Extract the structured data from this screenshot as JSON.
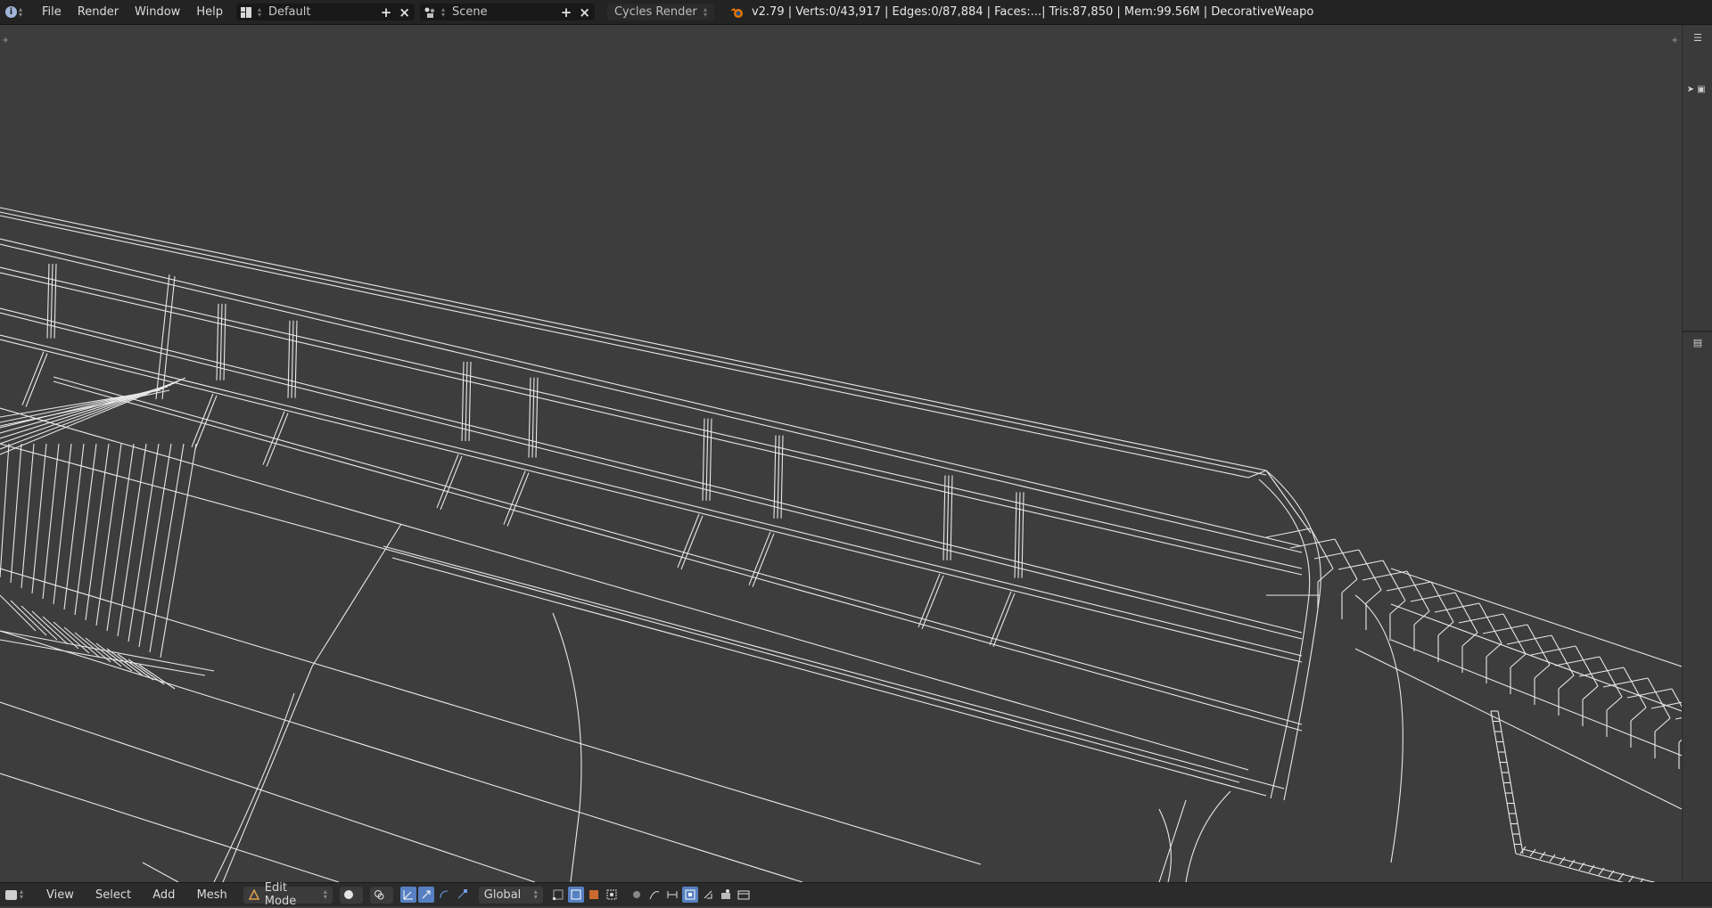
{
  "top_header": {
    "menus": [
      "File",
      "Render",
      "Window",
      "Help"
    ],
    "screen_layout": "Default",
    "scene": "Scene",
    "render_engine": "Cycles Render",
    "stats": "v2.79 | Verts:0/43,917 | Edges:0/87,884 | Faces:...| Tris:87,850 | Mem:99.56M | DecorativeWeapo"
  },
  "viewport_header": {
    "menus": [
      "View",
      "Select",
      "Add",
      "Mesh"
    ],
    "mode": "Edit Mode",
    "transform_orientation": "Global"
  },
  "colors": {
    "viewport_background": "#3d3d3d",
    "wire": "#e6e6e6",
    "active_toggle": "#5680c2"
  },
  "icons": {
    "editor_type": "info-icon",
    "viewport_editor": "3d-view-icon",
    "blender": "blender-logo-icon"
  }
}
